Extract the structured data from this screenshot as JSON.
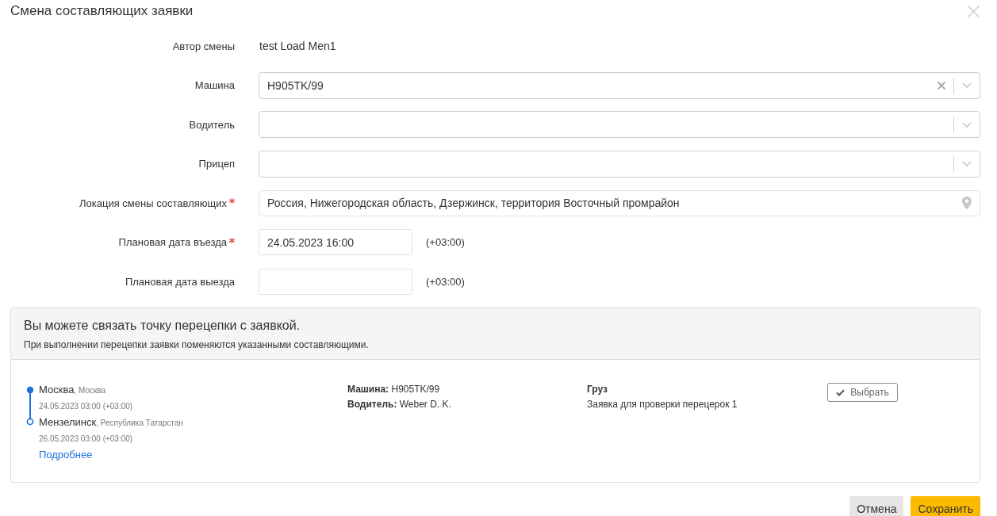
{
  "dialog": {
    "title": "Смена составляющих заявки"
  },
  "form": {
    "fields": [
      {
        "kind": "text",
        "label": "Автор смены",
        "value": "test Load Men1",
        "required": false
      },
      {
        "kind": "select",
        "label": "Машина",
        "value": "H905TK/99",
        "required": false
      },
      {
        "kind": "select",
        "label": "Водитель",
        "required": false
      },
      {
        "kind": "select",
        "label": "Прицеп",
        "required": false
      },
      {
        "kind": "location",
        "label": "Локация смены составляющих",
        "value": "Россия, Нижегородская область, Дзержинск, территория Восточный промрайон",
        "required": true
      },
      {
        "kind": "datetime",
        "label": "Плановая дата въезда",
        "value": "24.05.2023 16:00",
        "timezone": "(+03:00)",
        "required": true
      },
      {
        "kind": "datetime",
        "label": "Плановая дата выезда",
        "timezone": "(+03:00)",
        "required": false
      }
    ]
  },
  "link_panel": {
    "heading": "Вы можете связать точку перецепки с заявкой.",
    "note": "При выполнении перецепки заявки поменяются указанными составляющими.",
    "orders": [
      {
        "stops": [
          {
            "kind": "start",
            "city": "Москва",
            "region": ", Москва",
            "time": "24.05.2023 03:00 (+03:00)"
          },
          {
            "kind": "end",
            "city": "Мензелинск",
            "region": ", Республика Татарстан",
            "time": "26.05.2023 03:00 (+03:00)"
          }
        ],
        "details_link": "Подробнее",
        "vehicle": "**Машина:** H905TK/99",
        "driver": "**Водитель:** Weber D. K.",
        "cargo_title": "Груз",
        "cargo": "Заявка для проверки перецерок 1",
        "select_button": "Выбрать"
      }
    ]
  },
  "footer": {
    "buttons": [
      {
        "kind": "secondary",
        "label": "Отмена"
      },
      {
        "kind": "primary",
        "label": "Сохранить"
      }
    ]
  }
}
